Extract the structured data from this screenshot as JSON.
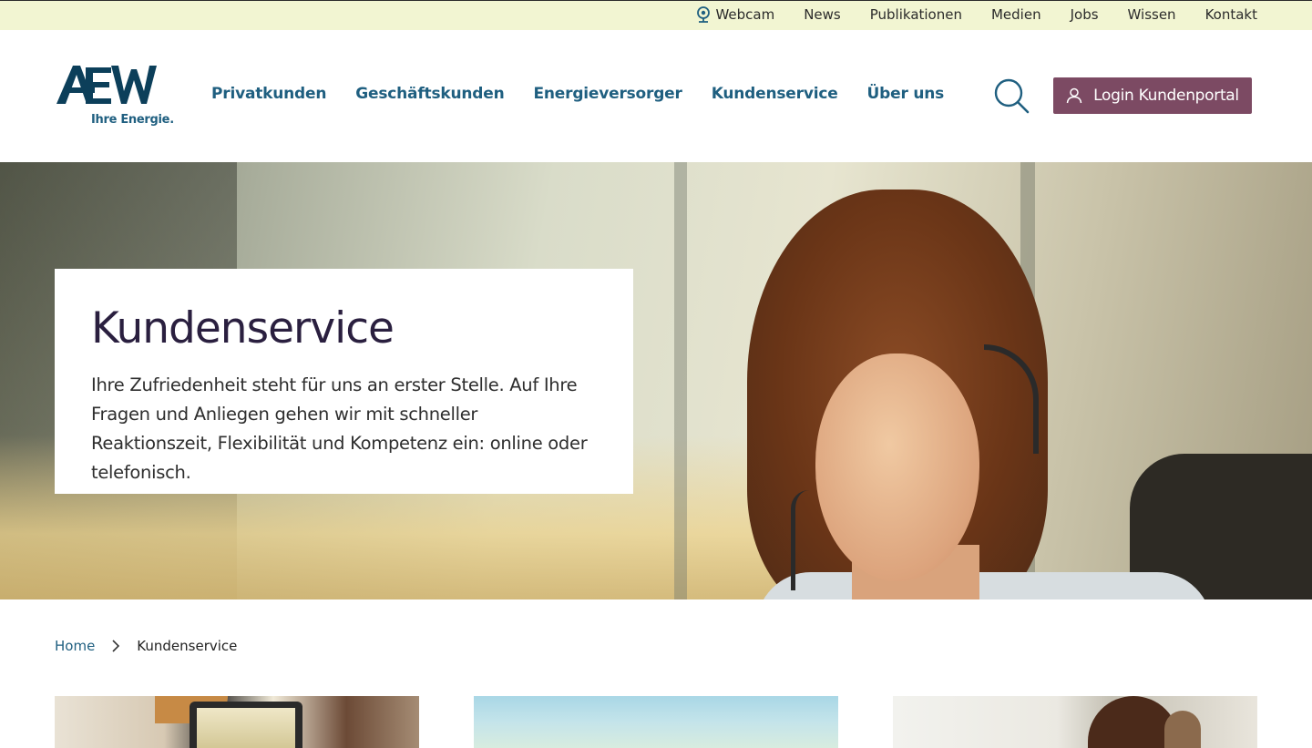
{
  "topbar": {
    "links": [
      "Webcam",
      "News",
      "Publikationen",
      "Medien",
      "Jobs",
      "Wissen",
      "Kontakt"
    ]
  },
  "header": {
    "logo_text": "AEW",
    "tagline": "Ihre Energie.",
    "nav": [
      "Privatkunden",
      "Geschäftskunden",
      "Energieversorger",
      "Kundenservice",
      "Über uns"
    ],
    "login_label": "Login Kundenportal"
  },
  "hero": {
    "title": "Kundenservice",
    "text": "Ihre Zufriedenheit steht für uns an erster Stelle. Auf Ihre Fragen und Anliegen gehen wir mit schneller Reaktionszeit, Flexibilität und Kompetenz ein: online oder telefonisch."
  },
  "breadcrumb": {
    "home": "Home",
    "current": "Kundenservice"
  },
  "colors": {
    "topbar_bg": "#f2f5d2",
    "nav_text": "#1f5f80",
    "login_bg": "#7c4a63",
    "title_text": "#2a1f3f"
  },
  "icons": {
    "webcam": "webcam-icon",
    "search": "search-icon",
    "user": "user-icon",
    "breadcrumb_separator": "chevron-right-icon"
  }
}
